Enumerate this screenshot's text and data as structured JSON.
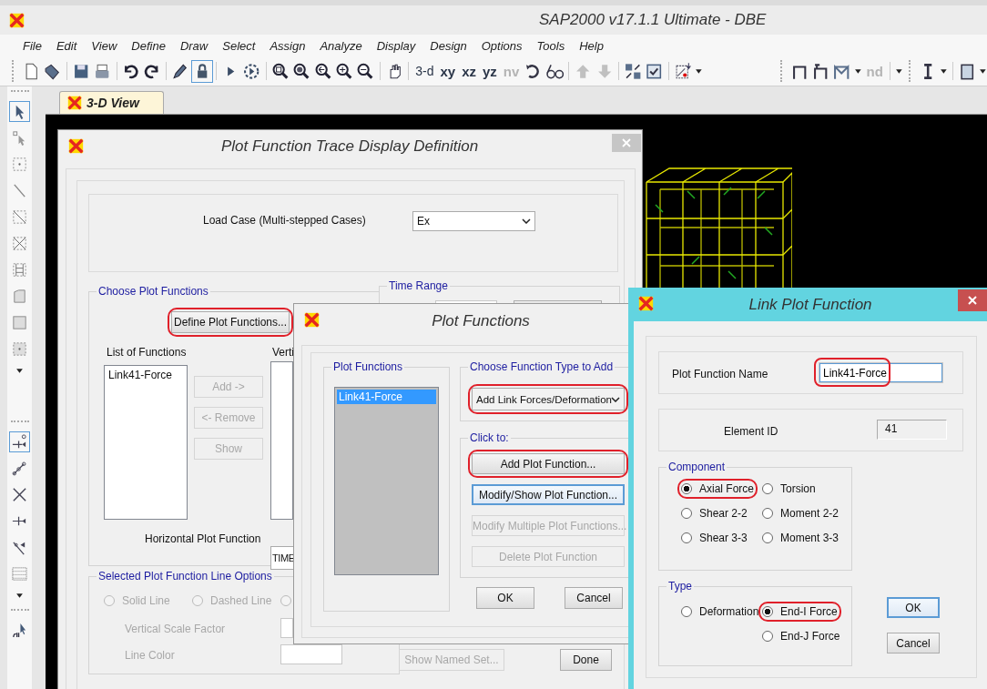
{
  "window": {
    "title": "SAP2000 v17.1.1 Ultimate  - DBE"
  },
  "menu": [
    "File",
    "Edit",
    "View",
    "Define",
    "Draw",
    "Select",
    "Assign",
    "Analyze",
    "Display",
    "Design",
    "Options",
    "Tools",
    "Help"
  ],
  "toolbar": {
    "view_buttons": [
      {
        "label": "3-d",
        "disabled": false
      },
      {
        "label": "xy",
        "disabled": false
      },
      {
        "label": "xz",
        "disabled": false
      },
      {
        "label": "yz",
        "disabled": false
      },
      {
        "label": "nv",
        "disabled": true
      }
    ],
    "nd_button": {
      "label": "nd",
      "disabled": true
    }
  },
  "tabs": [
    {
      "label": "3-D View",
      "selected": true
    }
  ],
  "trace_dialog": {
    "title": "Plot Function Trace Display Definition",
    "load_case": {
      "label": "Load Case (Multi-stepped Cases)",
      "value": "Ex"
    },
    "choose_group": {
      "title": "Choose Plot Functions",
      "define_button": {
        "label": "Define Plot Functions...",
        "highlighted": true
      },
      "list_label": "List of Functions",
      "functions": [
        {
          "label": "Link41-Force",
          "selected": false
        }
      ],
      "vertical_label": "Verti",
      "buttons": [
        {
          "label": "Add ->",
          "disabled": true
        },
        {
          "label": "<- Remove",
          "disabled": true
        },
        {
          "label": "Show",
          "disabled": true
        }
      ],
      "horizontal_label": "Horizontal Plot Function",
      "horizontal_value": "TIME"
    },
    "time_range": {
      "title": "Time Range"
    },
    "line_options": {
      "title": "Selected Plot Function Line Options",
      "disabled": true,
      "styles": [
        {
          "label": "Solid Line",
          "checked": false
        },
        {
          "label": "Dashed Line",
          "checked": false
        },
        {
          "checked": false
        }
      ],
      "scale_label": "Vertical  Scale Factor",
      "color_label": "Line Color"
    },
    "buttons": [
      {
        "label": "Show Named Set...",
        "disabled": true
      },
      {
        "label": "Done",
        "disabled": false
      }
    ]
  },
  "functions_dialog": {
    "title": "Plot Functions",
    "list_title": "Plot Functions",
    "items": [
      {
        "label": "Link41-Force",
        "selected": true
      }
    ],
    "type_group": {
      "title": "Choose  Function Type to Add",
      "value": "Add Link Forces/Deformation",
      "highlighted": true
    },
    "click_group": {
      "title": "Click to:",
      "buttons": [
        {
          "label": "Add Plot Function...",
          "disabled": false,
          "focused": false,
          "highlighted": true
        },
        {
          "label": "Modify/Show Plot Function...",
          "disabled": false,
          "focused": true,
          "highlighted": false
        },
        {
          "label": "Modify Multiple Plot Functions...",
          "disabled": true,
          "focused": false,
          "highlighted": false
        },
        {
          "label": "Delete Plot Function",
          "disabled": true,
          "focused": false,
          "highlighted": false
        }
      ]
    },
    "buttons": [
      {
        "label": "OK"
      },
      {
        "label": "Cancel"
      }
    ]
  },
  "link_dialog": {
    "title": "Link Plot Function",
    "name": {
      "label": "Plot Function Name",
      "value": "Link41-Force",
      "highlighted": true
    },
    "element": {
      "label": "Element ID",
      "value": "41"
    },
    "component": {
      "title": "Component",
      "options": [
        {
          "label": "Axial Force",
          "checked": true,
          "highlighted": true
        },
        {
          "label": "Torsion",
          "checked": false,
          "highlighted": false
        },
        {
          "label": "Shear 2-2",
          "checked": false,
          "highlighted": false
        },
        {
          "label": "Moment 2-2",
          "checked": false,
          "highlighted": false
        },
        {
          "label": "Shear 3-3",
          "checked": false,
          "highlighted": false
        },
        {
          "label": "Moment 3-3",
          "checked": false,
          "highlighted": false
        }
      ]
    },
    "type": {
      "title": "Type",
      "options": [
        {
          "label": "Deformation",
          "checked": false,
          "highlighted": false
        },
        {
          "label": "End-I Force",
          "checked": true,
          "highlighted": true
        },
        {
          "label": "End-J Force",
          "checked": false,
          "highlighted": false
        }
      ]
    },
    "buttons": [
      {
        "label": "OK",
        "default": true
      },
      {
        "label": "Cancel",
        "default": false
      }
    ]
  }
}
